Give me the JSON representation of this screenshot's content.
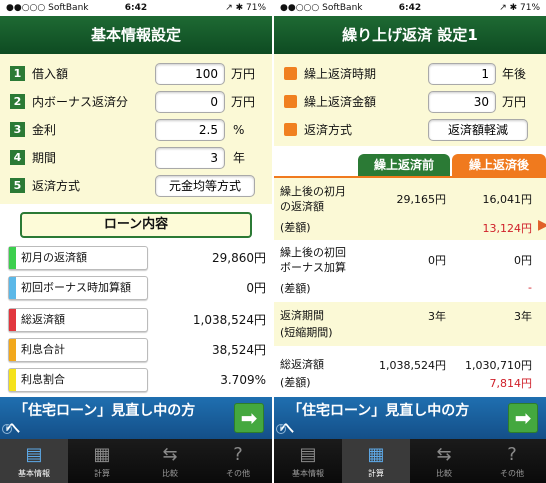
{
  "status": {
    "carrier": "●●○○○ SoftBank",
    "wifi": "⌔",
    "time": "6:42",
    "right": "↗ ✱ 71%"
  },
  "left": {
    "title": "基本情報設定",
    "rows": [
      {
        "num": "1",
        "label": "借入額",
        "value": "100",
        "unit": "万円"
      },
      {
        "num": "2",
        "label": "内ボーナス返済分",
        "value": "0",
        "unit": "万円"
      },
      {
        "num": "3",
        "label": "金利",
        "value": "2.5",
        "unit": "%"
      },
      {
        "num": "4",
        "label": "期間",
        "value": "3",
        "unit": "年"
      },
      {
        "num": "5",
        "label": "返済方式",
        "value": "元金均等方式",
        "unit": ""
      }
    ],
    "loan_header": "ローン内容",
    "loan_rows": [
      {
        "label": "初月の返済額",
        "value": "29,860円",
        "color": "#3ccf4e"
      },
      {
        "label": "初回ボーナス時加算額",
        "value": "0円",
        "color": "#5bb8e8"
      },
      {
        "label": "総返済額",
        "value": "1,038,524円",
        "color": "#e2363e"
      },
      {
        "label": "利息合計",
        "value": "38,524円",
        "color": "#f2a81c"
      },
      {
        "label": "利息割合",
        "value": "3.709%",
        "color": "#f5e21a"
      }
    ]
  },
  "right": {
    "title": "繰り上げ返済 設定1",
    "settings": [
      {
        "label": "繰上返済時期",
        "value": "1",
        "unit": "年後"
      },
      {
        "label": "繰上返済金額",
        "value": "30",
        "unit": "万円"
      },
      {
        "label": "返済方式",
        "value": "返済額軽減",
        "unit": ""
      }
    ],
    "tab_before": "繰上返済前",
    "tab_after": "繰上返済後",
    "compare": [
      {
        "l1": "繰上後の初月",
        "l2": "の返済額",
        "before": "29,165円",
        "after": "16,041円",
        "diff_label": "(差額)",
        "diff": "13,124円"
      },
      {
        "l1": "繰上後の初回",
        "l2": "ボーナス加算",
        "before": "0円",
        "after": "0円",
        "diff_label": "(差額)",
        "diff": "-"
      },
      {
        "l1": "返済期間",
        "l2": "(短縮期間)",
        "before": "3年",
        "after": "3年",
        "diff_label": "",
        "diff": ""
      },
      {
        "l1": "総返済額",
        "l2": "(差額)",
        "before": "1,038,524円",
        "after": "1,030,710円",
        "diff_label": "",
        "diff": "7,814円"
      }
    ]
  },
  "banner": {
    "line1": "「住宅ローン」見直し中の方",
    "line2": "へ",
    "info": "i",
    "arrow": "➡"
  },
  "tabs": [
    {
      "icon": "document-icon",
      "glyph": "▤",
      "label": "基本情報"
    },
    {
      "icon": "calculator-icon",
      "glyph": "▦",
      "label": "計算"
    },
    {
      "icon": "compare-icon",
      "glyph": "⇆",
      "label": "比較"
    },
    {
      "icon": "help-icon",
      "glyph": "?",
      "label": "その他"
    }
  ],
  "colors": {
    "header_green": "#1e6a33",
    "cream": "#fbf9d6",
    "banner_blue": "#1f6fb0",
    "tab_before": "#2b7a35",
    "tab_after": "#f07a1e",
    "diff_red": "#d0202a"
  }
}
